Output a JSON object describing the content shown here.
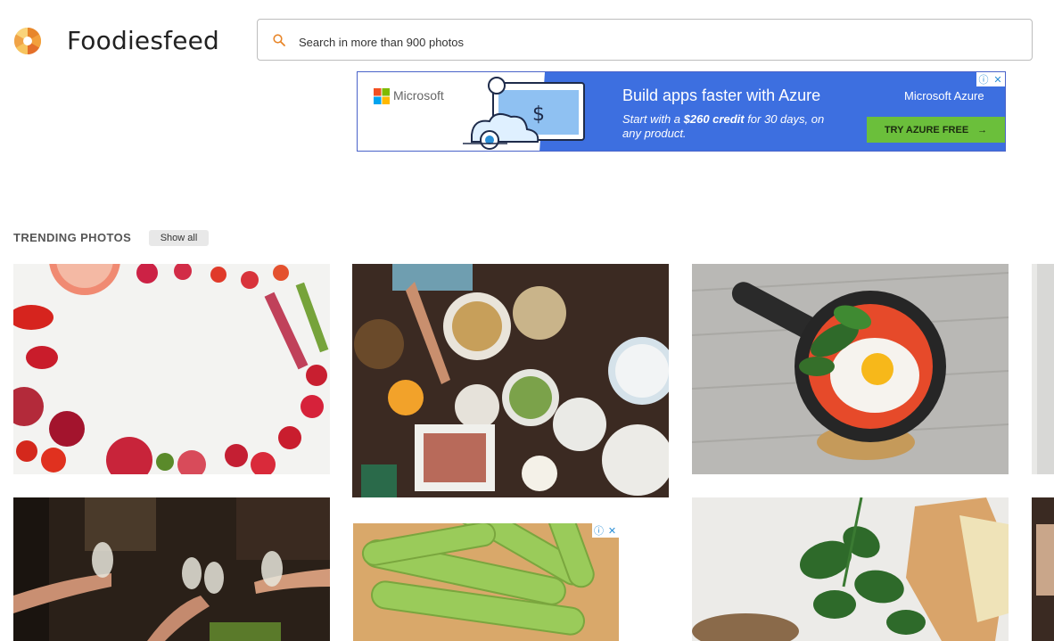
{
  "header": {
    "brand": "Foodiesfeed",
    "search_placeholder": "Search in more than 900 photos"
  },
  "ad_banner": {
    "advertiser": "Microsoft",
    "headline": "Build apps faster with Azure",
    "sub_prefix": "Start with a ",
    "sub_bold": "$260 credit",
    "sub_suffix": " for 30 days, on any product.",
    "product": "Microsoft Azure",
    "cta": "TRY AZURE FREE",
    "cta_arrow": "→",
    "info_glyph": "ⓘ",
    "close_glyph": "✕"
  },
  "trending": {
    "title": "TRENDING PHOTOS",
    "show_all": "Show all"
  },
  "small_ad": {
    "info_glyph": "ⓘ",
    "close_glyph": "✕"
  },
  "colors": {
    "accent_orange": "#e8862a",
    "azure_blue": "#3d6fe0",
    "azure_cta_green": "#6bbf3b"
  }
}
